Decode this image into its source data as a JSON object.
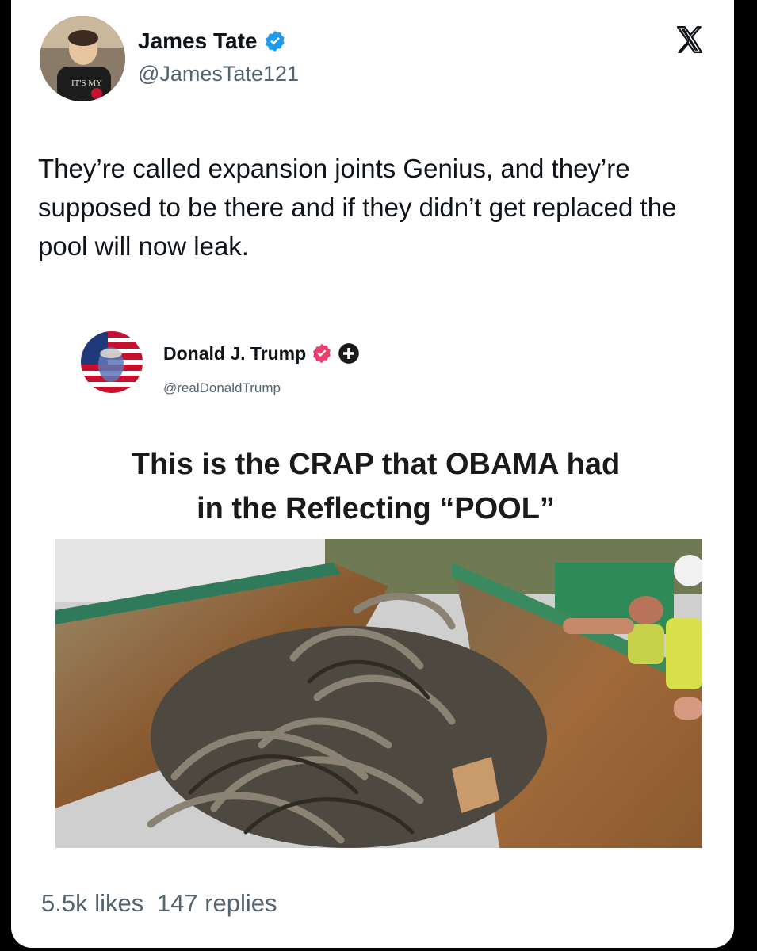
{
  "author": {
    "name": "James Tate",
    "handle": "@JamesTate121",
    "avatar_caption": "IT'S MY"
  },
  "platform_icon": "x-logo-icon",
  "tweet_text": "They’re called expansion joints Genius, and they’re supposed to be there and if they didn’t get replaced the pool will now leak.",
  "quoted_post": {
    "name": "Donald J. Trump",
    "handle": "@realDonaldTrump",
    "badges": [
      "verified-pink-badge-icon",
      "plus-badge-icon"
    ],
    "headline_line1": "This is the CRAP that OBAMA had",
    "headline_line2": "in the Reflecting “POOL”"
  },
  "stats": {
    "likes": "5.5k likes",
    "replies": "147 replies"
  },
  "colors": {
    "verified_blue": "#1d9bf0",
    "verified_pink": "#e8406e",
    "text_primary": "#0f1419",
    "text_secondary": "#536471"
  }
}
